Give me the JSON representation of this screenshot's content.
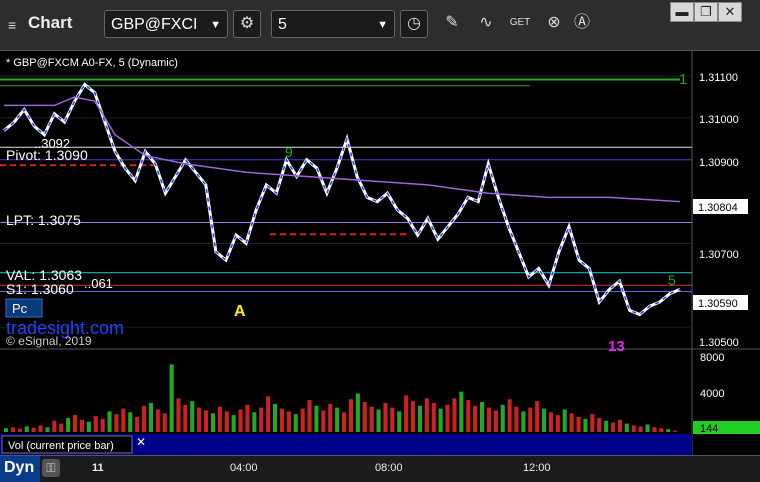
{
  "window": {
    "app_title": "Chart",
    "symbol": "GBP@FXCI",
    "interval": "5",
    "buttons": [
      "▬",
      "❐",
      "✕"
    ]
  },
  "colors": {
    "background": "#000000",
    "up_bar": "#ffffff",
    "down_bar": "#1a3cff",
    "price_line": "#9966dd",
    "green_line": "#22aa22",
    "red_dash": "#dd2020",
    "volume": "#cc2222",
    "vol_badge": "#22cc22",
    "panel_blue": "#00008b"
  },
  "chart_data": [
    {
      "type": "candlestick",
      "title": "* GBP@FXCM A0-FX, 5 (Dynamic)",
      "ylim": [
        1.3045,
        1.3116
      ],
      "y_ticks": [
        "1.31100",
        "1.31000",
        "1.30900",
        "1.30804",
        "1.30700",
        "1.30590",
        "1.30500"
      ],
      "x_ticks": [
        "11",
        "04:00",
        "08:00",
        "12:00"
      ],
      "levels": [
        {
          "label": "Pivot: 1.3090",
          "value": 1.309
        },
        {
          "label": "LPT: 1.3075",
          "value": 1.3075
        },
        {
          "label": "VAL: 1.3063",
          "value": 1.3063
        },
        {
          "label": "S1: 1.3060",
          "value": 1.306
        }
      ],
      "annotations": [
        "A",
        "1",
        "5",
        "9",
        "13"
      ],
      "watermark": "tradesight.com",
      "copyright": "© eSignal, 2019",
      "badge": "Pc",
      "current_price": 1.3059,
      "moving_average_label": 1.30804,
      "overlaps": [
        "..3092",
        "..061"
      ],
      "price_path": [
        [
          0,
          1.3097
        ],
        [
          4,
          1.3099
        ],
        [
          8,
          1.3102
        ],
        [
          12,
          1.3098
        ],
        [
          16,
          1.3096
        ],
        [
          20,
          1.3101
        ],
        [
          24,
          1.3099
        ],
        [
          28,
          1.3104
        ],
        [
          32,
          1.3108
        ],
        [
          36,
          1.3106
        ],
        [
          40,
          1.3099
        ],
        [
          44,
          1.3092
        ],
        [
          48,
          1.3088
        ],
        [
          52,
          1.3085
        ],
        [
          56,
          1.3092
        ],
        [
          60,
          1.3089
        ],
        [
          64,
          1.3082
        ],
        [
          68,
          1.3086
        ],
        [
          72,
          1.309
        ],
        [
          76,
          1.3087
        ],
        [
          80,
          1.3084
        ],
        [
          84,
          1.3068
        ],
        [
          88,
          1.3066
        ],
        [
          92,
          1.3072
        ],
        [
          96,
          1.307
        ],
        [
          100,
          1.3078
        ],
        [
          104,
          1.3084
        ],
        [
          108,
          1.3082
        ],
        [
          112,
          1.309
        ],
        [
          116,
          1.3086
        ],
        [
          120,
          1.309
        ],
        [
          124,
          1.3088
        ],
        [
          128,
          1.3082
        ],
        [
          132,
          1.3088
        ],
        [
          136,
          1.3095
        ],
        [
          140,
          1.3086
        ],
        [
          144,
          1.3081
        ],
        [
          148,
          1.308
        ],
        [
          152,
          1.3082
        ],
        [
          156,
          1.3078
        ],
        [
          160,
          1.3076
        ],
        [
          164,
          1.3072
        ],
        [
          168,
          1.3076
        ],
        [
          172,
          1.3071
        ],
        [
          176,
          1.3074
        ],
        [
          180,
          1.3077
        ],
        [
          184,
          1.3081
        ],
        [
          188,
          1.308
        ],
        [
          192,
          1.3089
        ],
        [
          196,
          1.3081
        ],
        [
          200,
          1.3074
        ],
        [
          204,
          1.3068
        ],
        [
          208,
          1.3062
        ],
        [
          212,
          1.3064
        ],
        [
          216,
          1.306
        ],
        [
          220,
          1.3068
        ],
        [
          224,
          1.3074
        ],
        [
          228,
          1.3066
        ],
        [
          232,
          1.3064
        ],
        [
          236,
          1.3056
        ],
        [
          240,
          1.3059
        ],
        [
          244,
          1.3061
        ],
        [
          248,
          1.3054
        ],
        [
          252,
          1.3053
        ],
        [
          256,
          1.3055
        ],
        [
          260,
          1.3056
        ],
        [
          264,
          1.3058
        ],
        [
          268,
          1.3059
        ]
      ],
      "ma_path": [
        [
          0,
          1.3103
        ],
        [
          20,
          1.3103
        ],
        [
          28,
          1.3105
        ],
        [
          36,
          1.3104
        ],
        [
          44,
          1.3096
        ],
        [
          56,
          1.3091
        ],
        [
          72,
          1.3089
        ],
        [
          96,
          1.3087
        ],
        [
          120,
          1.3086
        ],
        [
          144,
          1.3085
        ],
        [
          168,
          1.3084
        ],
        [
          192,
          1.3082
        ],
        [
          216,
          1.3081
        ],
        [
          240,
          1.3081
        ],
        [
          268,
          1.308
        ]
      ],
      "volume": {
        "ylim": [
          0,
          8000
        ],
        "y_ticks": [
          "8000",
          "4000"
        ],
        "label": "Vol (current price bar)",
        "current": "144",
        "values": [
          400,
          500,
          350,
          600,
          450,
          700,
          500,
          1200,
          900,
          1500,
          1800,
          1300,
          1100,
          1700,
          1400,
          2200,
          1900,
          2500,
          2100,
          1600,
          2800,
          3100,
          2400,
          2000,
          7200,
          3600,
          2900,
          3300,
          2600,
          2300,
          2000,
          2700,
          2200,
          1800,
          2400,
          2900,
          2100,
          2600,
          3800,
          3000,
          2500,
          2200,
          1900,
          2500,
          3400,
          2800,
          2300,
          3000,
          2600,
          2100,
          3500,
          4100,
          3200,
          2700,
          2400,
          3100,
          2600,
          2200,
          3900,
          3300,
          2800,
          3600,
          3100,
          2500,
          2900,
          3600,
          4300,
          3400,
          2800,
          3200,
          2600,
          2300,
          2900,
          3500,
          2700,
          2200,
          2600,
          3300,
          2500,
          2100,
          1800,
          2400,
          2000,
          1600,
          1400,
          1900,
          1500,
          1200,
          1000,
          1300,
          900,
          700,
          600,
          800,
          500,
          400,
          300,
          144
        ]
      }
    }
  ],
  "bottombar": {
    "mode": "Dyn",
    "lock_icon": "lock-icon"
  }
}
